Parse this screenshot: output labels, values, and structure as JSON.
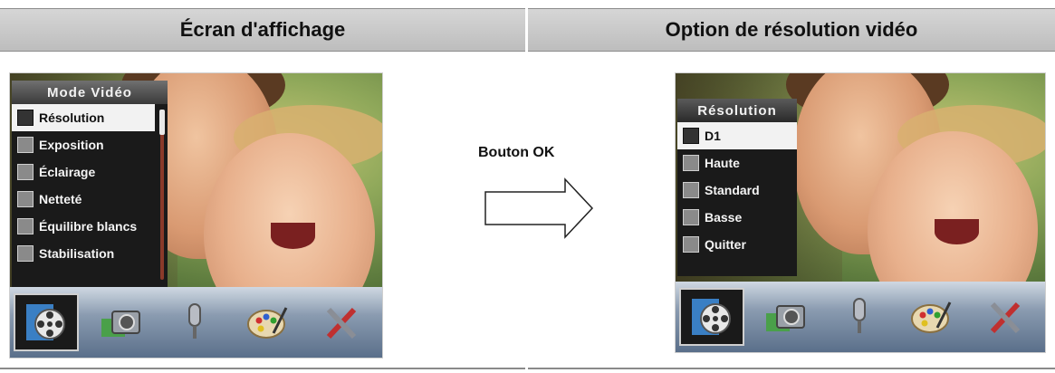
{
  "headers": {
    "left": "Écran d'affichage",
    "right": "Option de résolution vidéo"
  },
  "left_screen": {
    "menu_title": "Mode Vidéo",
    "items": [
      {
        "label": "Résolution",
        "selected": true
      },
      {
        "label": "Exposition",
        "selected": false
      },
      {
        "label": "Éclairage",
        "selected": false
      },
      {
        "label": "Netteté",
        "selected": false
      },
      {
        "label": "Équilibre blancs",
        "selected": false
      },
      {
        "label": "Stabilisation",
        "selected": false
      }
    ]
  },
  "arrow_label": "Bouton OK",
  "right_screen": {
    "menu_title": "Résolution",
    "items": [
      {
        "label": "D1",
        "selected": true
      },
      {
        "label": "Haute",
        "selected": false
      },
      {
        "label": "Standard",
        "selected": false
      },
      {
        "label": "Basse",
        "selected": false
      },
      {
        "label": "Quitter",
        "selected": false
      }
    ]
  },
  "toolbar_icons": [
    "film-reel-icon",
    "camera-icon",
    "microphone-icon",
    "palette-icon",
    "tools-icon"
  ],
  "colors": {
    "header_bg": "#c8c8c8",
    "menu_bg": "#1a1a1a",
    "selected_bg": "#f2f2f2",
    "toolbar_blue": "#6a7f9a"
  }
}
